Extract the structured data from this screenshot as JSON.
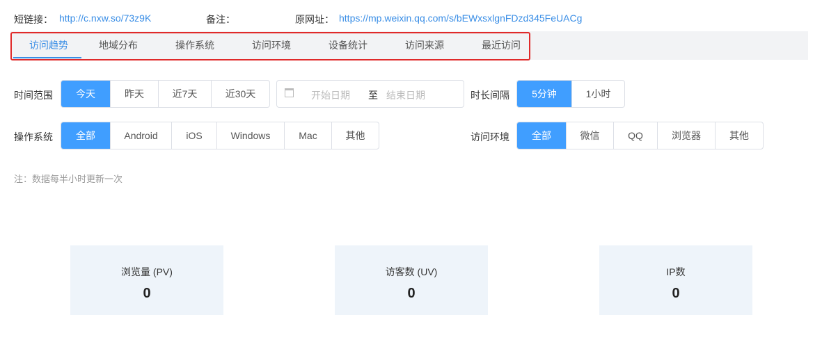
{
  "header": {
    "short_label": "短链接：",
    "short_url": "http://c.nxw.so/73z9K",
    "remark_label": "备注：",
    "orig_label": "原网址：",
    "orig_url": "https://mp.weixin.qq.com/s/bEWxsxlgnFDzd345FeUACg"
  },
  "tabs": [
    {
      "label": "访问趋势",
      "active": true
    },
    {
      "label": "地域分布"
    },
    {
      "label": "操作系统"
    },
    {
      "label": "访问环境"
    },
    {
      "label": "设备统计"
    },
    {
      "label": "访问来源"
    },
    {
      "label": "最近访问"
    }
  ],
  "filters": {
    "time_range": {
      "label": "时间范围",
      "options": [
        "今天",
        "昨天",
        "近7天",
        "近30天"
      ],
      "selected": "今天"
    },
    "date": {
      "start_placeholder": "开始日期",
      "separator": "至",
      "end_placeholder": "结束日期"
    },
    "interval": {
      "label": "时长间隔",
      "options": [
        "5分钟",
        "1小时"
      ],
      "selected": "5分钟"
    },
    "os": {
      "label": "操作系统",
      "options": [
        "全部",
        "Android",
        "iOS",
        "Windows",
        "Mac",
        "其他"
      ],
      "selected": "全部"
    },
    "env": {
      "label": "访问环境",
      "options": [
        "全部",
        "微信",
        "QQ",
        "浏览器",
        "其他"
      ],
      "selected": "全部"
    }
  },
  "note": "注：数据每半小时更新一次",
  "stats": [
    {
      "label": "浏览量 (PV)",
      "value": "0"
    },
    {
      "label": "访客数 (UV)",
      "value": "0"
    },
    {
      "label": "IP数",
      "value": "0"
    }
  ],
  "colors": {
    "accent": "#409eff",
    "highlight": "#e02a2a"
  }
}
